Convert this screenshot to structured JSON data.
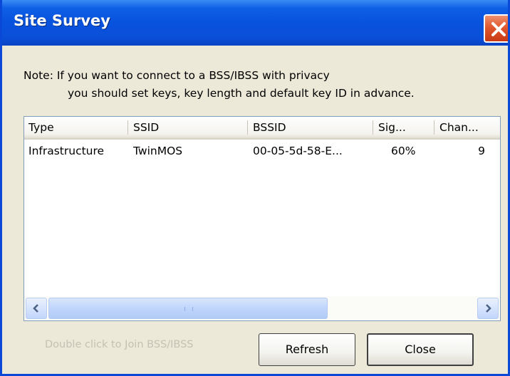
{
  "window": {
    "title": "Site Survey"
  },
  "note": {
    "line1": "Note: If you want to connect to a BSS/IBSS with privacy",
    "line2": "you should set keys, key length and default key ID in advance."
  },
  "table": {
    "columns": [
      "Type",
      "SSID",
      "BSSID",
      "Sig...",
      "Chan..."
    ],
    "rows": [
      [
        "Infrastructure",
        "TwinMOS",
        "00-05-5d-58-E...",
        "60%",
        "9"
      ]
    ]
  },
  "footer": {
    "hint": "Double click to Join BSS/IBSS",
    "refresh_label": "Refresh",
    "close_label": "Close"
  },
  "icons": {
    "close": "close-x-icon",
    "scroll_left": "arrow-left-icon",
    "scroll_right": "arrow-right-icon"
  },
  "colors": {
    "titlebar": "#0852de",
    "close_button": "#e0582e",
    "dialog_bg": "#ece9d8",
    "scrollbar": "#c0d5fb"
  }
}
